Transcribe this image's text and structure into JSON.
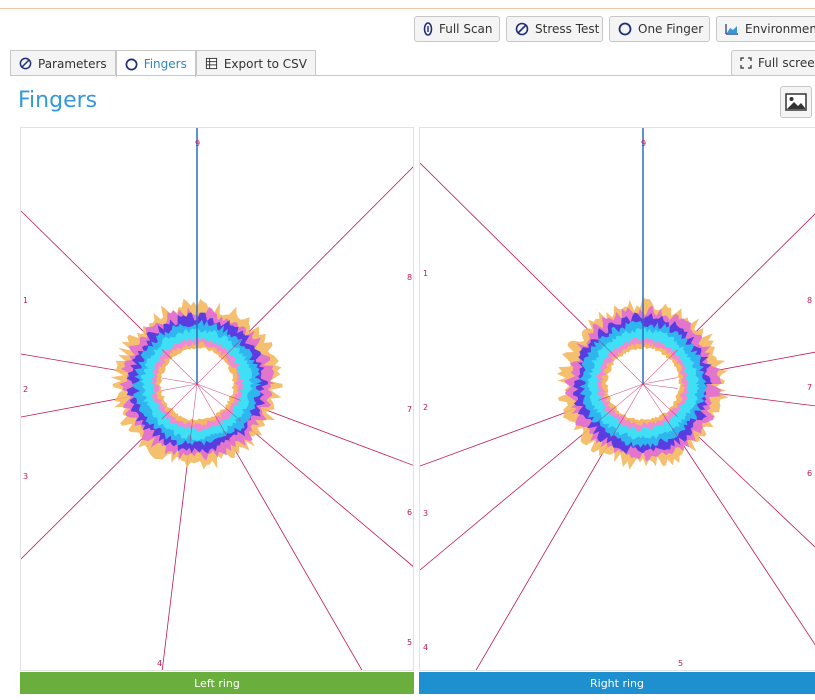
{
  "toolbar": {
    "full_scan": "Full Scan",
    "stress_test": "Stress Test",
    "one_finger": "One Finger",
    "environment": "Environment"
  },
  "tabs": [
    {
      "label": "Parameters",
      "icon": "parameters-icon"
    },
    {
      "label": "Fingers",
      "icon": "finger-ring-icon",
      "active": true
    },
    {
      "label": "Export to CSV",
      "icon": "csv-icon"
    }
  ],
  "fullscreen_label": "Full screen",
  "page_title": "Fingers",
  "colors": {
    "accent": "#3498db",
    "left_footer": "#6aaf3d",
    "right_footer": "#1e90d0",
    "radial_lines": "#c2185b",
    "needle": "#2e6dbd"
  },
  "panels": [
    {
      "footer": "Left ring",
      "needle_label": "9",
      "labels": [
        "1",
        "2",
        "3",
        "4",
        "5",
        "6",
        "7",
        "8"
      ]
    },
    {
      "footer": "Right ring",
      "needle_label": "9",
      "labels": [
        "1",
        "2",
        "3",
        "4",
        "5",
        "6",
        "7",
        "8"
      ]
    }
  ]
}
